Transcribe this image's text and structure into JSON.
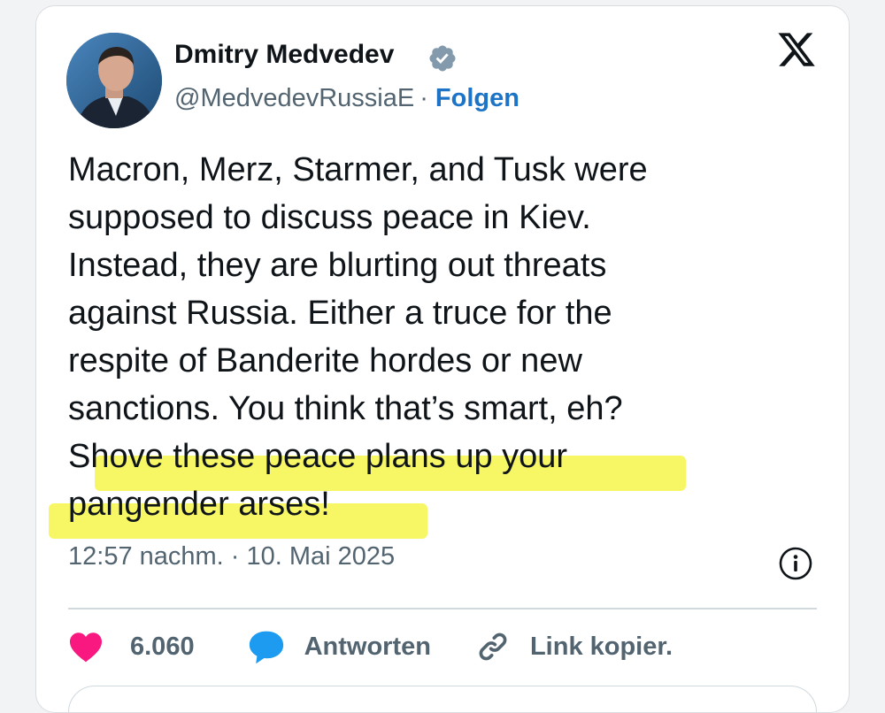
{
  "author": {
    "name": "Dmitry Medvedev",
    "handle": "@MedvedevRussiaE",
    "separator": "·",
    "follow_label": "Folgen",
    "verified_badge_icon": "verified-badge-icon"
  },
  "tweet": {
    "lines": [
      "Macron, Merz, Starmer, and Tusk were",
      "supposed to discuss peace in Kiev.",
      "Instead, they are blurting out threats",
      "against Russia. Either a truce for the",
      "respite of Banderite hordes or new",
      "sanctions. You think that’s smart, eh?",
      "Shove these peace plans up your",
      "pangender arses!"
    ],
    "timestamp": "12:57 nachm. · 10. Mai 2025"
  },
  "actions": {
    "likes_count": "6.060",
    "reply_label": "Antworten",
    "copy_link_label": "Link kopier."
  },
  "colors": {
    "text": "#0f1419",
    "secondary": "#536471",
    "link": "#1d74c7",
    "like": "#f91880",
    "reply": "#1d9bf0",
    "highlight": "#f5f53b"
  }
}
